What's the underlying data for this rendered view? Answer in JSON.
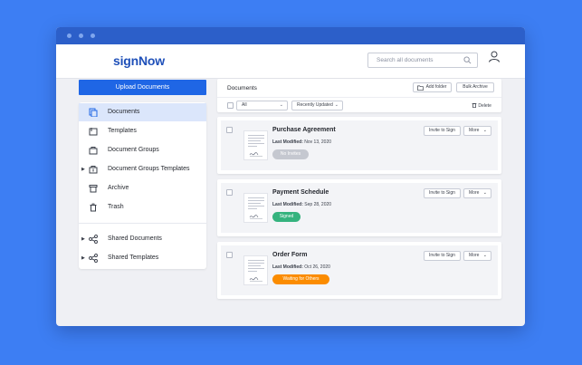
{
  "app": {
    "logo": "signNow"
  },
  "search": {
    "placeholder": "Search all documents"
  },
  "sidebar": {
    "upload_label": "Upload Documents",
    "items": [
      {
        "label": "Documents"
      },
      {
        "label": "Templates"
      },
      {
        "label": "Document Groups"
      },
      {
        "label": "Document Groups Templates"
      },
      {
        "label": "Archive"
      },
      {
        "label": "Trash"
      },
      {
        "label": "Shared Documents"
      },
      {
        "label": "Shared Templates"
      }
    ]
  },
  "docs": {
    "title": "Documents",
    "add_folder_label": "Add folder",
    "bulk_archive_label": "Bulk Archive",
    "filter_value": "All",
    "sort_value": "Recently Updated",
    "delete_label": "Delete",
    "modified_label": "Last Modified:",
    "invite_label": "Invite to Sign",
    "more_label": "More",
    "items": [
      {
        "name": "Purchase Agreement",
        "modified": "Nov 13, 2020",
        "status": "No Invites",
        "status_color": "#c5c8d0"
      },
      {
        "name": "Payment Schedule",
        "modified": "Sep 28, 2020",
        "status": "Signed",
        "status_color": "#35b37e"
      },
      {
        "name": "Order Form",
        "modified": "Oct 26, 2020",
        "status": "Waiting for Others",
        "status_color": "#fb8c00"
      }
    ]
  },
  "colors": {
    "background": "#3d7ef3",
    "titlebar": "#2c5fc9",
    "accent": "#1f66e5",
    "logo": "#1f50b9"
  }
}
